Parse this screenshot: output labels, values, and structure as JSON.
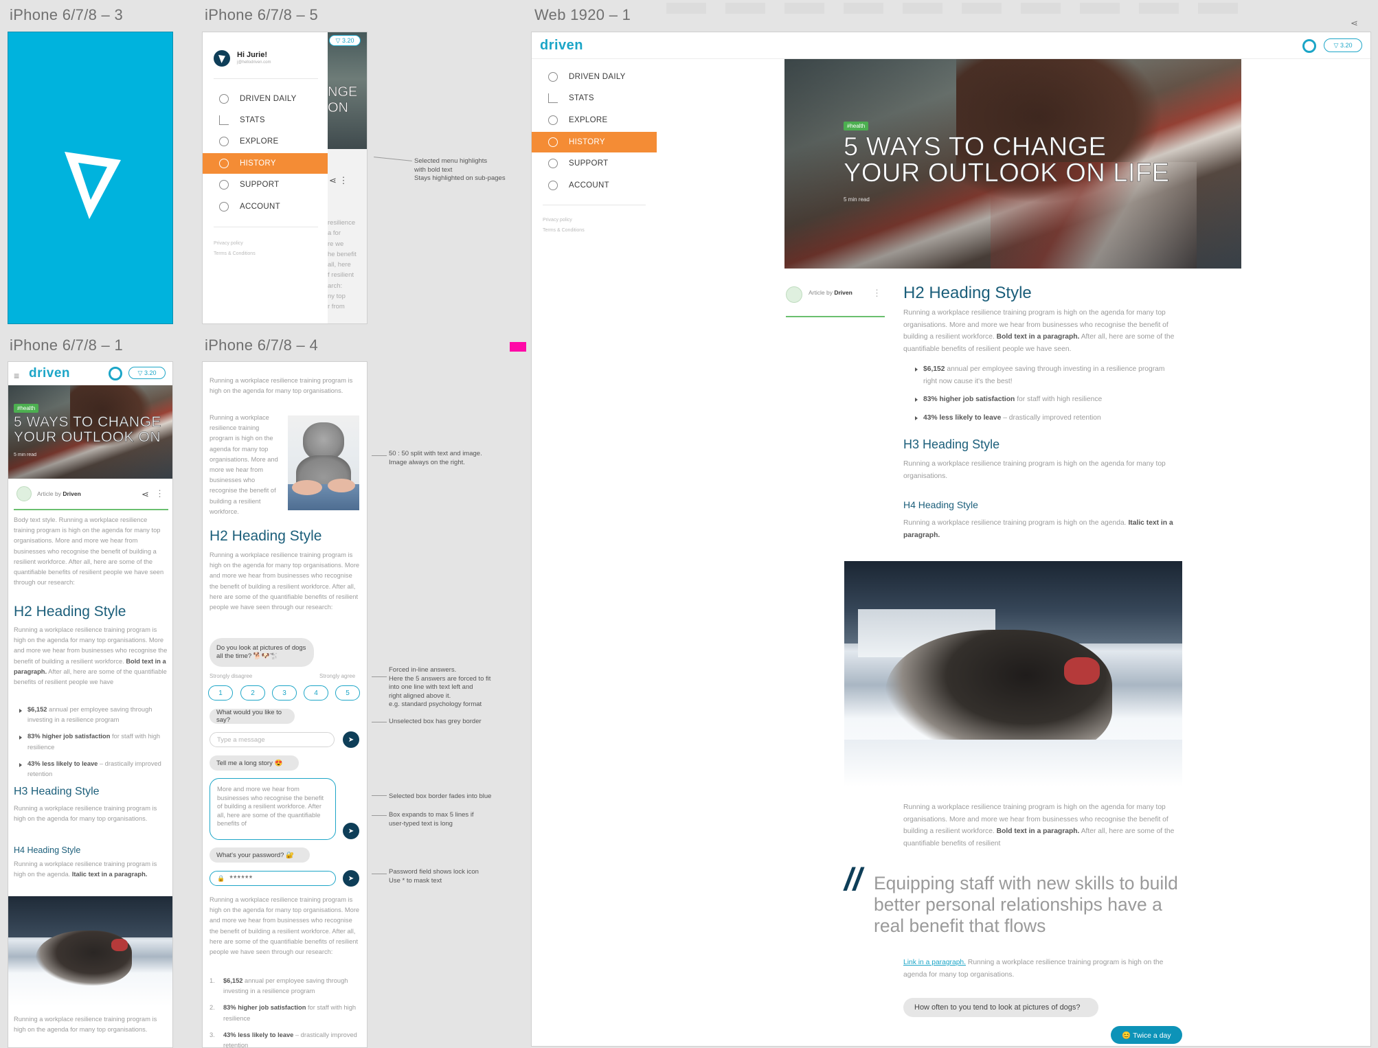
{
  "artboards": {
    "a3": "iPhone 6/7/8 – 3",
    "a5": "iPhone 6/7/8 – 5",
    "web": "Web 1920 – 1",
    "a1": "iPhone 6/7/8 – 1",
    "a4": "iPhone 6/7/8 – 4"
  },
  "colors": {
    "splash": "#00b3dd",
    "accent": "#f48c35",
    "brand": "#1ba5c7",
    "heading": "#1b5e7a",
    "tag": "#4caf50",
    "send": "#0e3e58",
    "pink": "#ff0aa7"
  },
  "brand": {
    "logo": "driven",
    "points": "3.20"
  },
  "menu": {
    "greeting": "Hi Jurie!",
    "email": "j@hellodriven.com",
    "items": [
      "DRIVEN DAILY",
      "STATS",
      "EXPLORE",
      "HISTORY",
      "SUPPORT",
      "ACCOUNT"
    ],
    "active": "HISTORY",
    "footer": [
      "Privacy policy",
      "Terms & Conditions"
    ],
    "peek_title": [
      "NGE",
      "ON"
    ],
    "peek_text": [
      "resilience",
      "a for",
      "re we",
      "he benefit",
      "all, here",
      "f resilient",
      "arch:",
      "",
      "",
      "ny top",
      "r from"
    ]
  },
  "notes": {
    "menu": [
      "Selected menu highlights",
      "with bold text",
      "Stays highlighted on sub-pages"
    ],
    "split": [
      "50 : 50 split with text and image.",
      "Image always on the right."
    ],
    "forced": [
      "Forced in-line answers.",
      "Here the 5 answers are forced to fit",
      "into one line with text left and",
      "right aligned above it.",
      "e.g. standard psychology format"
    ],
    "unselected": [
      "Unselected box has grey border"
    ],
    "selected": [
      "Selected box border fades into blue"
    ],
    "expands": [
      "Box expands to max 5 lines if",
      "user-typed text is long"
    ],
    "password": [
      "Password field shows lock icon",
      "Use * to mask text"
    ]
  },
  "article": {
    "tag": "#health",
    "title_line1": "5 WAYS TO CHANGE",
    "title_line2": "YOUR OUTLOOK ON LIFE",
    "title_mobile_2": "YOUR OUTLOOK ON",
    "read": "5 min read",
    "by_prefix": "Article by ",
    "by_name": "Driven",
    "intro_mobile": "Body text style. Running a workplace resilience training program is high on the agenda for many top organisations. More and more we hear from businesses who recognise the benefit of building a resilient workforce. After all, here are some of the quantifiable benefits of resilient people we have seen through our research:",
    "h2": "H2 Heading Style",
    "h3": "H3 Heading Style",
    "h4": "H4 Heading Style",
    "p_main": "Running a workplace resilience training program is high on the agenda for many top organisations. More and more we hear from businesses who recognise the benefit of building a resilient workforce.",
    "p_bold": "Bold text in a paragraph.",
    "p_after": "After all, here are some of the quantifiable benefits of resilient people we have seen.",
    "p_after_mobile": "After all, here are some of the quantifiable benefits of resilient people we have",
    "p_short": "Running a workplace resilience training program is high on the agenda for many top organisations.",
    "p_h4": "Running a workplace resilience training program is high on the agenda.",
    "p_italic": "Italic text in a paragraph.",
    "bullets": [
      {
        "bold": "$6,152",
        "rest": " annual per employee saving through investing in a resilience program right now cause it's the best!"
      },
      {
        "bold": "83% higher job satisfaction",
        "rest": " for staff with high resilience"
      },
      {
        "bold": "43% less likely to leave",
        "rest": " – drastically improved retention"
      }
    ],
    "bullets_m": [
      {
        "bold": "$6,152",
        "rest": " annual per employee saving through investing in a resilience program"
      },
      {
        "bold": "83% higher job satisfaction",
        "rest": " for staff with high resilience"
      },
      {
        "bold": "43% less likely to leave",
        "rest": " – drastically improved retention"
      }
    ],
    "p_after_dog": "Running a workplace resilience training program is high on the agenda for many top organisations. More and more we hear from businesses who recognise the benefit of building a resilient workforce.",
    "p_after_dog_end": "After all, here are some of the quantifiable benefits of resilient",
    "quote": "Equipping staff with new skills to build better personal relationships have a real benefit that flows",
    "link": "Link in a paragraph.",
    "link_rest": " Running a workplace resilience training program is high on the agenda for many top organisations.",
    "question": "How often to you tend to look at pictures of dogs?",
    "answer": "😊 Twice a day",
    "m1_bottom": "Running a workplace resilience training program is high on the agenda for many top organisations."
  },
  "chat": {
    "p1": "Running a workplace resilience training program is high on the agenda for many top organisations.",
    "p_split": "Running a workplace resilience training program is high on the agenda for many top organisations. More and more we hear from businesses who recognise the benefit of building a resilient workforce.",
    "p_research": "Running a workplace resilience training program is high on the agenda for many top organisations. More and more we hear from businesses who recognise the benefit of building a resilient workforce. After all, here are some of the quantifiable benefits of resilient people we have seen through our research:",
    "q1": "Do you look at pictures of dogs all the time? 🐕🐶🐩",
    "scale_left": "Strongly disagree",
    "scale_right": "Strongly agree",
    "scale": [
      "1",
      "2",
      "3",
      "4",
      "5"
    ],
    "q2": "What would you like to say?",
    "placeholder": "Type a message",
    "q3": "Tell me a long story 😍",
    "long": "More and more we hear from businesses who recognise the benefit of building a resilient workforce. After all, here are some of the quantifiable benefits of",
    "q4": "What's your password? 🔐",
    "password": "******",
    "numbered": [
      {
        "n": "1.",
        "bold": "$6,152",
        "rest": " annual per employee saving through investing in a resilience program"
      },
      {
        "n": "2.",
        "bold": "83% higher job satisfaction",
        "rest": " for staff with high resilience"
      },
      {
        "n": "3.",
        "bold": "43% less likely to leave",
        "rest": " – drastically improved retention"
      }
    ]
  }
}
